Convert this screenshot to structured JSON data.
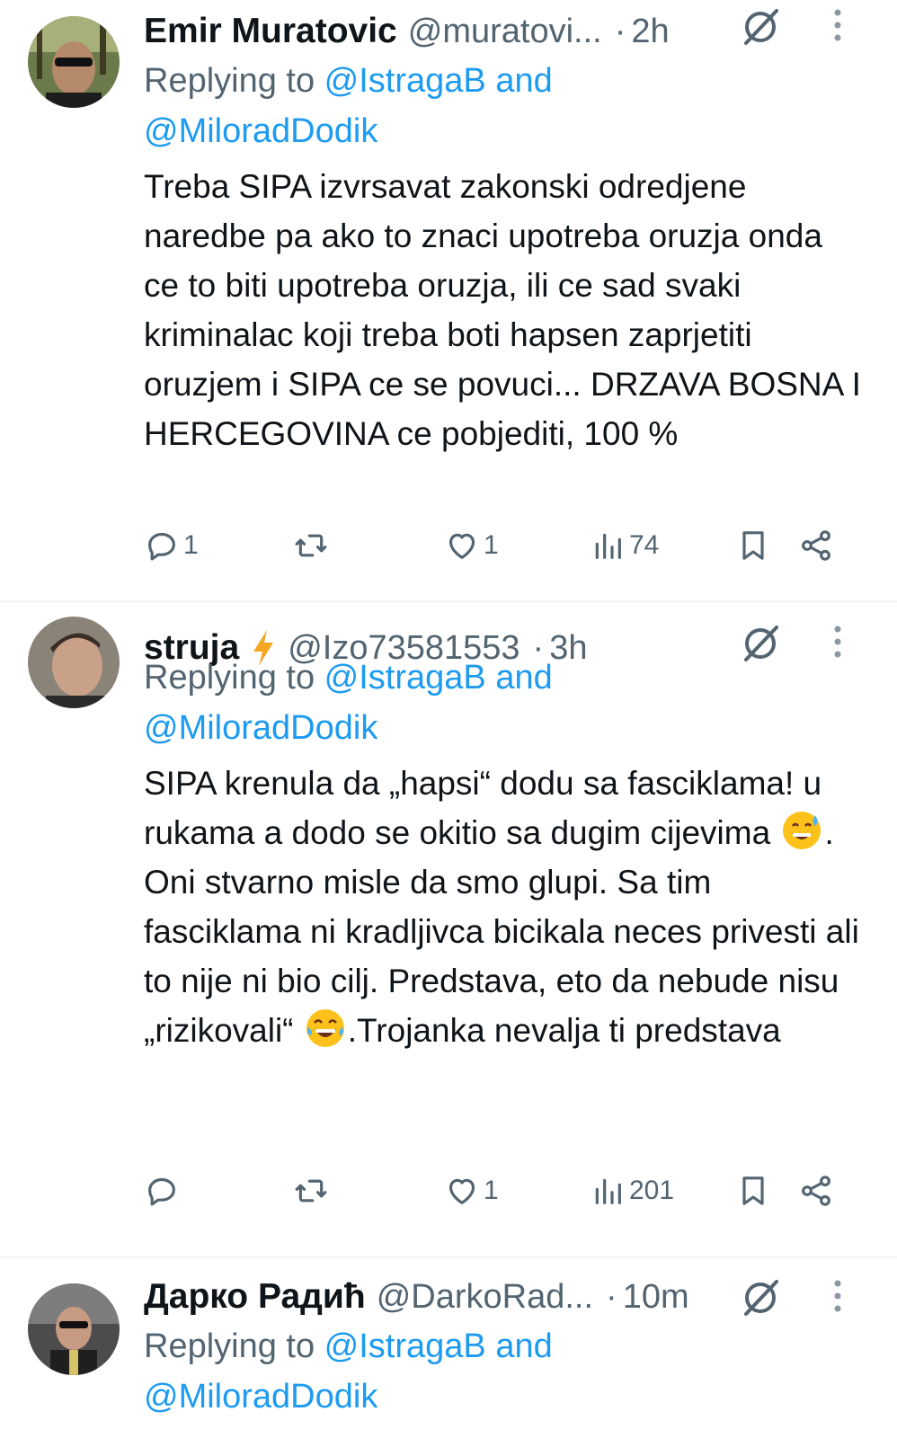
{
  "tweets": [
    {
      "name": "Emir Muratovic",
      "handle": "@muratovi...",
      "time": "2h",
      "replying_prefix": "Replying to ",
      "replying_mentions": "@IstragaB and\n@MiloradDodik",
      "body": "Treba SIPA izvrsavat zakonski odredjene naredbe pa ako to znaci upotreba oruzja onda ce to biti upotreba oruzja, ili ce sad svaki kriminalac koji treba boti hapsen zaprjetiti oruzjem i SIPA ce se povuci... DRZAVA BOSNA I HERCEGOVINA ce pobjediti, 100 %",
      "replies": "1",
      "retweets": "",
      "likes": "1",
      "views": "74"
    },
    {
      "name": "struja",
      "handle": "@Izo73581553",
      "time": "3h",
      "replying_prefix": "Replying to ",
      "replying_mentions": "@IstragaB and\n@MiloradDodik",
      "body_parts": [
        "SIPA krenula da „hapsi“ dodu sa fasciklama! u rukama a dodo se okitio sa dugim cijevima ",
        ". Oni stvarno misle da smo glupi. Sa tim fasciklama ni kradljivca bicikala neces privesti ali to nije ni bio cilj. Predstava, eto da nebude nisu „rizikovali“ ",
        ".Trojanka nevalja ti predstava"
      ],
      "replies": "",
      "retweets": "",
      "likes": "1",
      "views": "201"
    },
    {
      "name": "Дарко Радић",
      "handle": "@DarkoRad...",
      "time": "10m",
      "replying_prefix": "Replying to ",
      "replying_mentions": "@IstragaB and\n@MiloradDodik"
    }
  ],
  "dot_separator": "·",
  "icons": [
    "reply-icon",
    "retweet-icon",
    "like-icon",
    "views-icon",
    "bookmark-icon",
    "share-icon",
    "grok-icon",
    "more-icon"
  ],
  "colors": {
    "link": "#1d9bf0",
    "secondary": "#536471",
    "text": "#0f1419",
    "bolt": "#f5a623"
  }
}
